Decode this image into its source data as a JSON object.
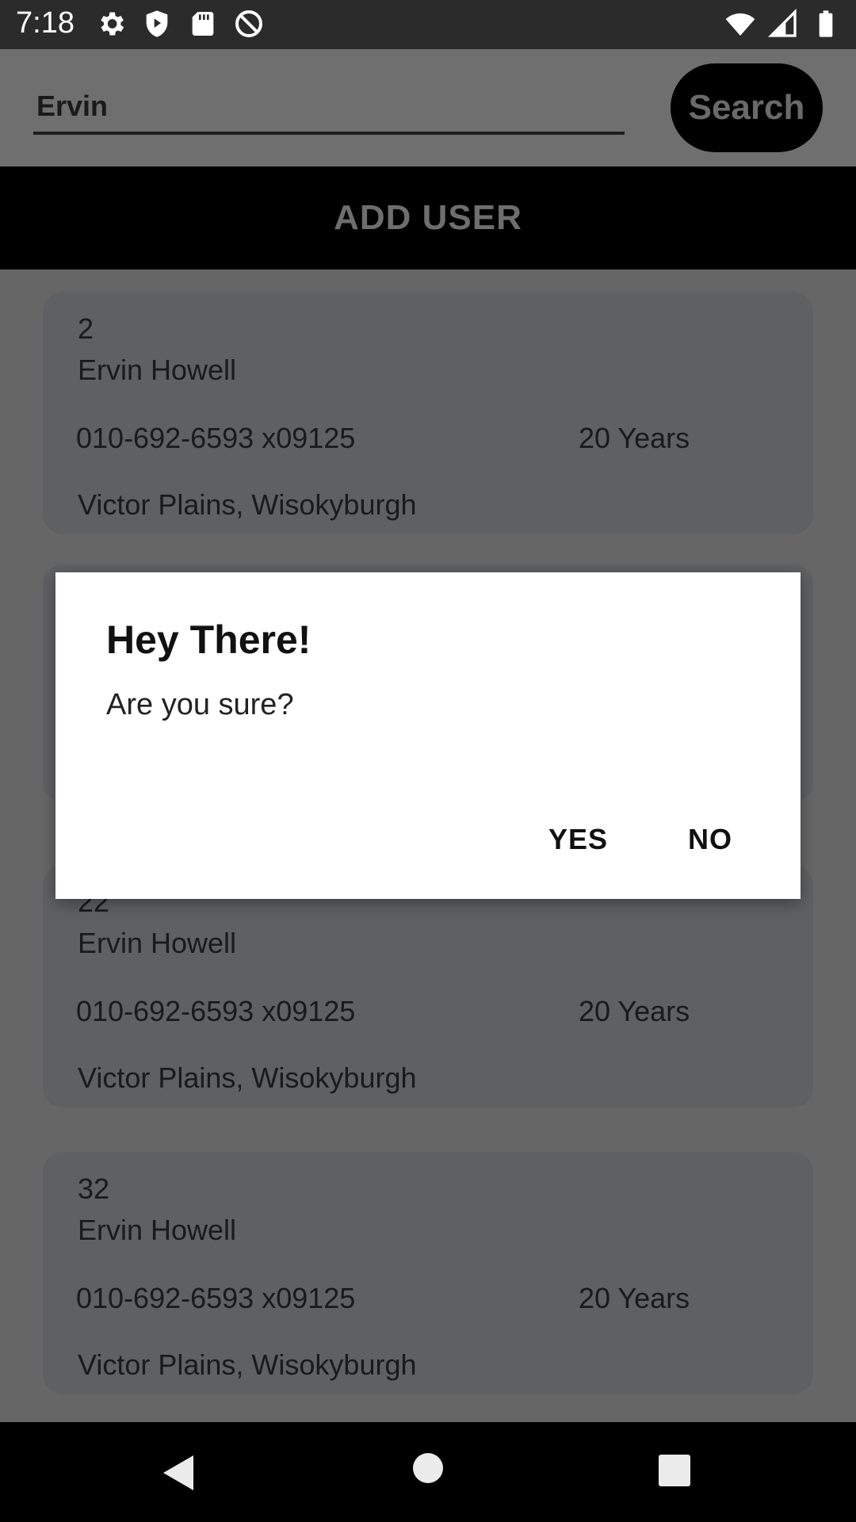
{
  "status_bar": {
    "time": "7:18",
    "left_icons": [
      "settings-icon",
      "shield-icon",
      "sd-card-icon",
      "at-sign-icon"
    ],
    "right_icons": [
      "wifi-icon",
      "signal-icon",
      "battery-icon"
    ]
  },
  "search": {
    "value": "Ervin",
    "button_label": "Search"
  },
  "add_user": {
    "label": "ADD USER"
  },
  "users": [
    {
      "id": "2",
      "name": "Ervin Howell",
      "phone": "010-692-6593 x09125",
      "age": "20 Years",
      "address": "Victor Plains, Wisokyburgh"
    },
    {
      "id": "22",
      "name": "Ervin Howell",
      "phone": "010-692-6593 x09125",
      "age": "20 Years",
      "address": "Victor Plains, Wisokyburgh"
    },
    {
      "id": "32",
      "name": "Ervin Howell",
      "phone": "010-692-6593 x09125",
      "age": "20 Years",
      "address": "Victor Plains, Wisokyburgh"
    }
  ],
  "dialog": {
    "title": "Hey There!",
    "message": "Are you sure?",
    "yes_label": "YES",
    "no_label": "NO"
  },
  "nav_bar": {
    "icons": [
      "back-icon",
      "home-icon",
      "recents-icon"
    ]
  },
  "colors": {
    "dialog_bg": "#ffffff",
    "bar_bg": "#000000",
    "scrim": "#6b6b6b",
    "card_bg": "#5f6062"
  }
}
